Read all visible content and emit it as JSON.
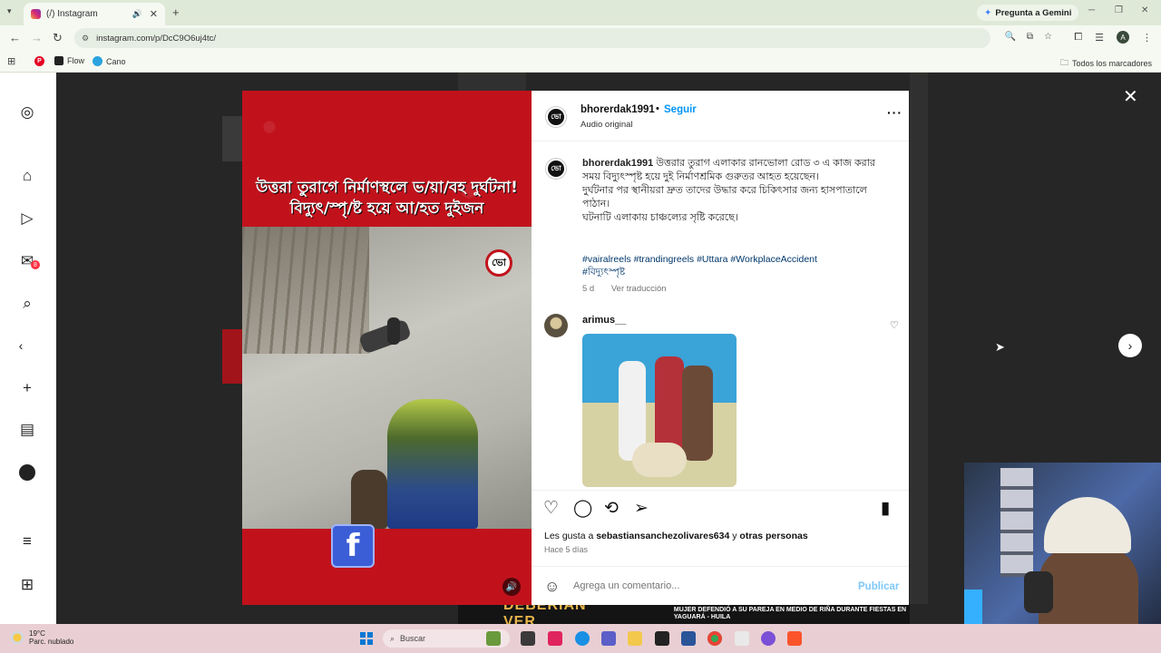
{
  "browser": {
    "tab_title": "(/) Instagram",
    "url": "instagram.com/p/DcC9O6uj4tc/",
    "gemini_label": "Pregunta a Gemini",
    "profile_initial": "A",
    "bookmarks": [
      {
        "label": "Flow"
      },
      {
        "label": "Cano"
      }
    ],
    "all_bookmarks_label": "Todos los marcadores"
  },
  "sidebar": {
    "notification_count": "8"
  },
  "media": {
    "headline_line1": "উত্তরা তুরাগে নির্মাণস্থলে ভ/য়া/বহ দুর্ঘটনা!",
    "headline_line2": "বিদ্যুৎ/স্পৃ/ষ্ট হয়ে আ/হত দুইজন",
    "badge": "ভো",
    "facebook_glyph": "f"
  },
  "post": {
    "username": "bhorerdak1991",
    "separator": "•",
    "follow_label": "Seguir",
    "audio_label": "Audio original",
    "caption_user": "bhorerdak1991",
    "caption_line1": "উত্তরার তুরাগ এলাকার রানভোলা রোড ৩ এ কাজ করার সময় বিদ্যুৎস্পৃষ্ট হয়ে দুই নির্মাণশ্রমিক গুরুতর আহত হয়েছেন।",
    "caption_line2": "দুর্ঘটনার পর স্থানীয়রা দ্রুত তাদের উদ্ধার করে চিকিৎসার জন্য হাসপাতালে পাঠান।",
    "caption_line3": "ঘটনাটি এলাকায় চাঞ্চল্যের সৃষ্টি করেছে।",
    "hashtags": "#vairalreels #trandingreels #Uttara #WorkplaceAccident #বিদ্যুৎস্পৃষ্ট",
    "time_ago": "5 d",
    "translate_label": "Ver traducción",
    "comment": {
      "username": "arimus__"
    },
    "likes_prefix": "Les gusta a",
    "likes_user": "sebastiansanchezolivares634",
    "likes_and": "y",
    "likes_others": "otras personas",
    "posted_ago": "Hace 5 días",
    "comment_placeholder": "Agrega un comentario...",
    "publish_label": "Publicar"
  },
  "background": {
    "banner_text": "DEBERÍAN VER",
    "banner_small": "MUJER DEFENDIÓ A SU PAREJA EN MEDIO DE RIÑA DURANTE FIESTAS EN YAGUARÁ - HUILA"
  },
  "taskbar": {
    "temperature": "19°C",
    "weather_desc": "Parc. nublado",
    "search_label": "Buscar"
  },
  "colors": {
    "ig_blue": "#0095f6",
    "media_red": "#c1121c",
    "link_blue": "#00376b"
  }
}
